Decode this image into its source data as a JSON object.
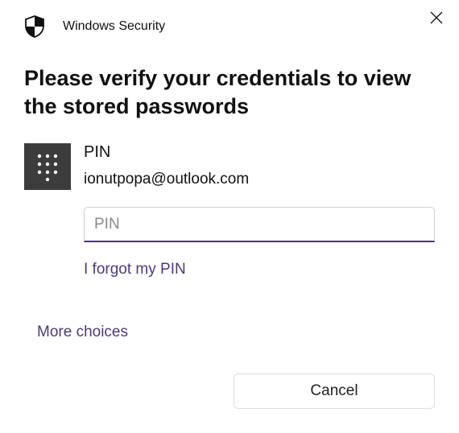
{
  "app_title": "Windows Security",
  "prompt_title": "Please verify your credentials to view the stored passwords",
  "credential": {
    "method_label": "PIN",
    "email": "ionutpopa@outlook.com",
    "pin_placeholder": "PIN"
  },
  "links": {
    "forgot_pin": "I forgot my PIN",
    "more_choices": "More choices"
  },
  "buttons": {
    "cancel": "Cancel"
  },
  "colors": {
    "accent": "#4b2e83",
    "link": "#4b3b7a",
    "icon_bg": "#3c3c3c"
  }
}
